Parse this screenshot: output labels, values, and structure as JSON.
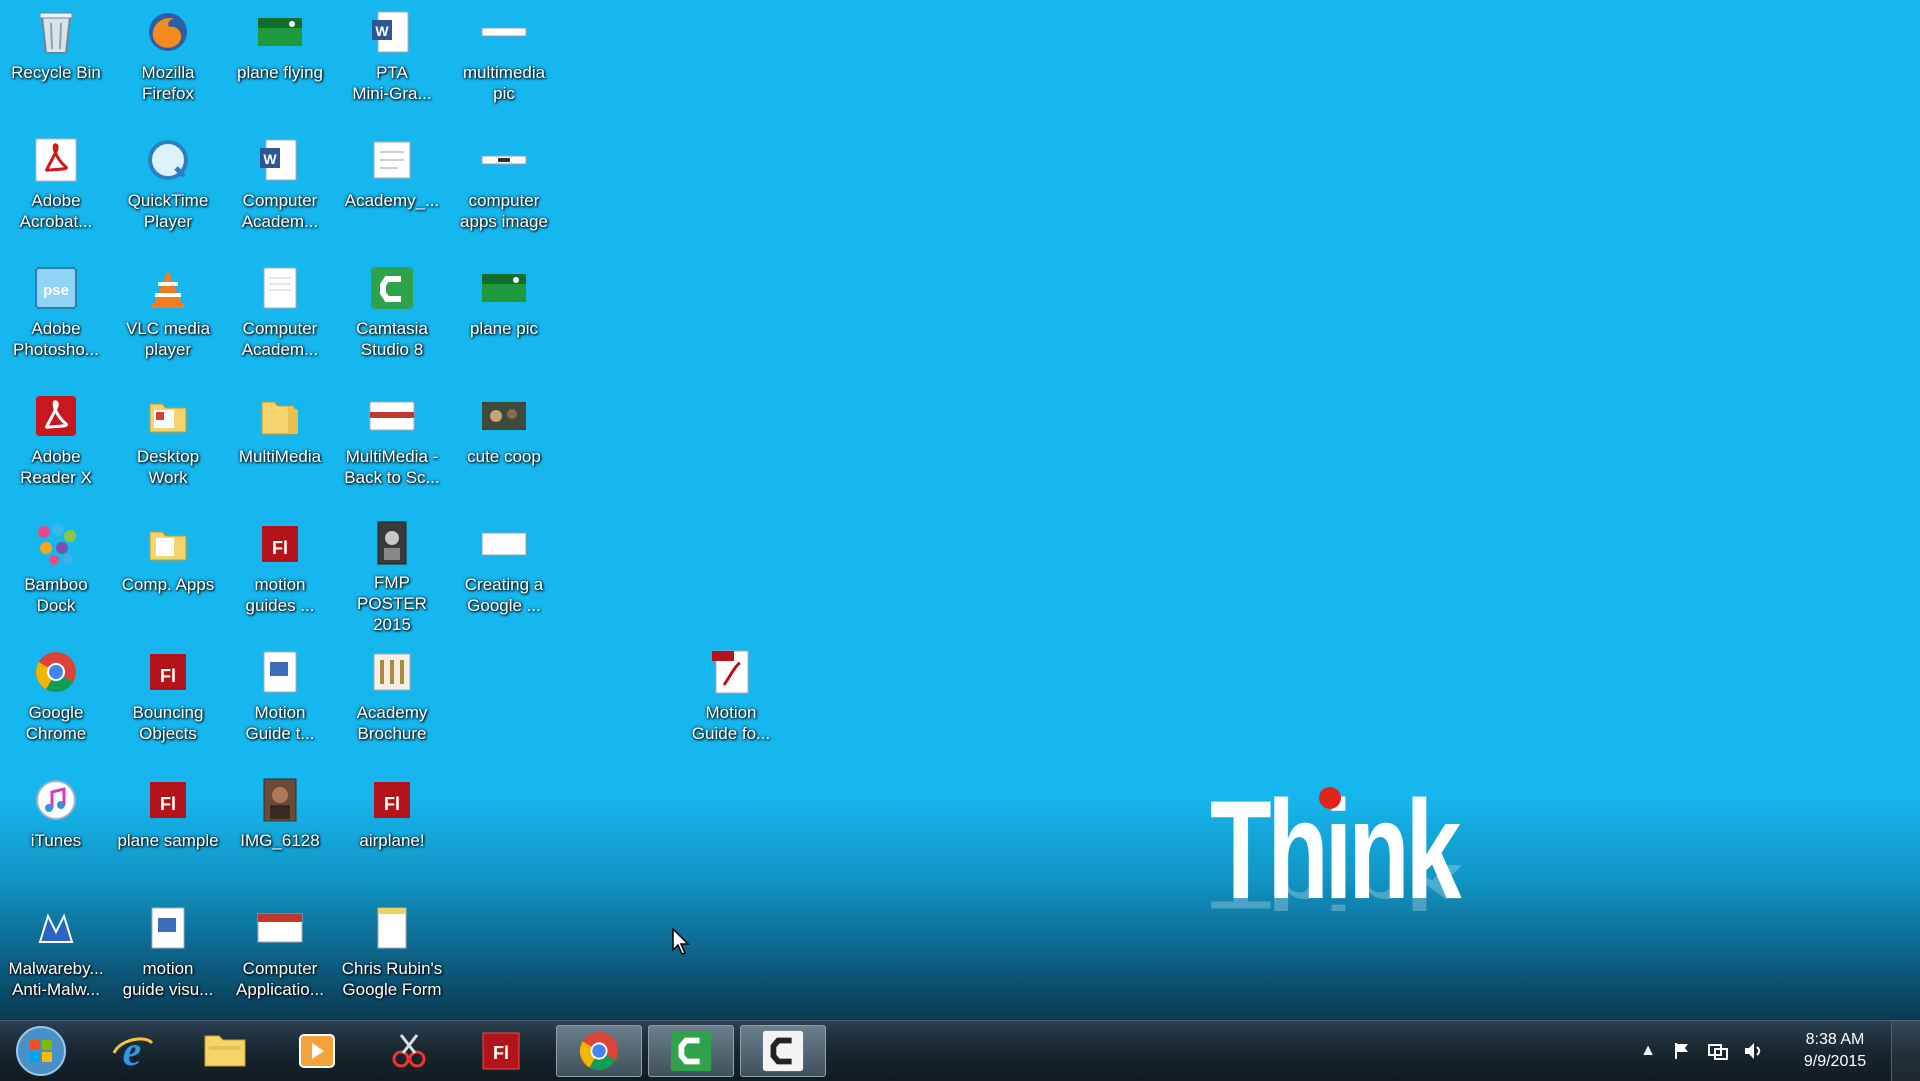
{
  "desktop": {
    "icons": [
      {
        "label": "Recycle Bin"
      },
      {
        "label": "Mozilla\nFirefox"
      },
      {
        "label": "plane flying"
      },
      {
        "label": "PTA\nMini-Gra..."
      },
      {
        "label": "multimedia\npic"
      },
      {
        "label": "Adobe\nAcrobat..."
      },
      {
        "label": "QuickTime\nPlayer"
      },
      {
        "label": "Computer\nAcadem..."
      },
      {
        "label": "Academy_..."
      },
      {
        "label": "computer\napps image"
      },
      {
        "label": "Adobe\nPhotosho..."
      },
      {
        "label": "VLC media\nplayer"
      },
      {
        "label": "Computer\nAcadem..."
      },
      {
        "label": "Camtasia\nStudio 8"
      },
      {
        "label": "plane pic"
      },
      {
        "label": "Adobe\nReader X"
      },
      {
        "label": "Desktop\nWork"
      },
      {
        "label": "MultiMedia"
      },
      {
        "label": "MultiMedia -\nBack to Sc..."
      },
      {
        "label": "cute coop"
      },
      {
        "label": "Bamboo\nDock"
      },
      {
        "label": "Comp. Apps"
      },
      {
        "label": "motion\nguides ..."
      },
      {
        "label": "FMP\nPOSTER 2015"
      },
      {
        "label": "Creating a\nGoogle ..."
      },
      {
        "label": "Google\nChrome"
      },
      {
        "label": "Bouncing\nObjects"
      },
      {
        "label": "Motion\nGuide t..."
      },
      {
        "label": "Academy\nBrochure"
      },
      {
        "label": "Motion\nGuide fo..."
      },
      {
        "label": "iTunes"
      },
      {
        "label": "plane sample"
      },
      {
        "label": "IMG_6128"
      },
      {
        "label": "airplane!"
      },
      {
        "label": "Malwareby...\nAnti-Malw..."
      },
      {
        "label": "motion\nguide visu..."
      },
      {
        "label": "Computer\nApplicatio..."
      },
      {
        "label": "Chris Rubin's\nGoogle Form"
      }
    ],
    "wallpaper_logo": "Think"
  },
  "taskbar": {
    "pinned": [
      "internet-explorer",
      "file-explorer",
      "media-player",
      "snipping-tool",
      "flash",
      "chrome",
      "camtasia-studio",
      "camtasia-recorder"
    ],
    "clock_time": "8:38 AM",
    "clock_date": "9/9/2015"
  },
  "colors": {
    "desktop_bg": "#16b6ee",
    "taskbar_bg": "#18262f",
    "think_dot": "#e2231a"
  }
}
